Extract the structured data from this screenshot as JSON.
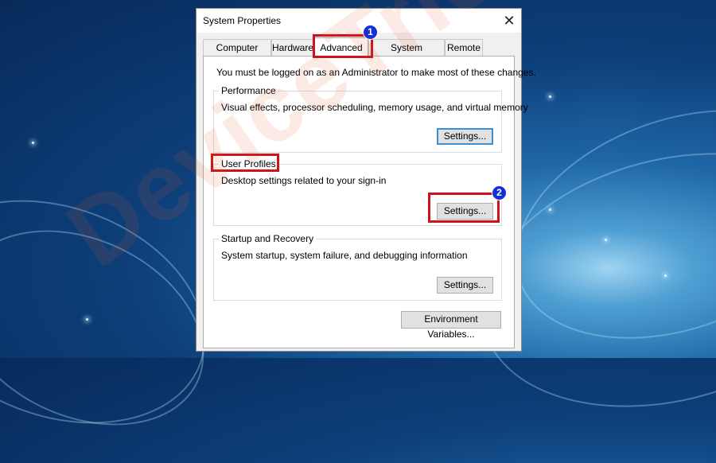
{
  "window": {
    "title": "System Properties",
    "close_glyph": "✕"
  },
  "tabs": [
    {
      "label": "Computer Name",
      "active": false
    },
    {
      "label": "Hardware",
      "active": false
    },
    {
      "label": "Advanced",
      "active": true
    },
    {
      "label": "System Protection",
      "active": false
    },
    {
      "label": "Remote",
      "active": false
    }
  ],
  "notice": "You must be logged on as an Administrator to make most of these changes.",
  "performance": {
    "title": "Performance",
    "description": "Visual effects, processor scheduling, memory usage, and virtual memory",
    "button": "Settings..."
  },
  "user_profiles": {
    "title": "User Profiles",
    "description": "Desktop settings related to your sign-in",
    "button": "Settings..."
  },
  "startup_recovery": {
    "title": "Startup and Recovery",
    "description": "System startup, system failure, and debugging information",
    "button": "Settings..."
  },
  "env_button": "Environment Variables...",
  "annotations": {
    "step1": "1",
    "step2": "2",
    "highlight_color": "#d0121b",
    "badge_color": "#1531d6"
  },
  "watermark": "DeviceTricks"
}
